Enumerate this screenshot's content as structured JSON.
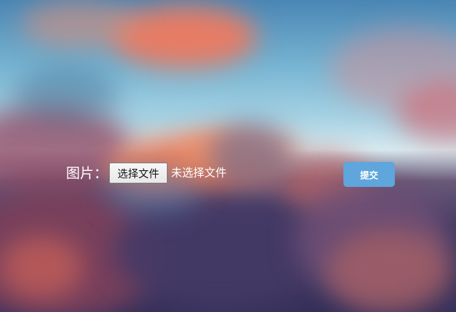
{
  "form": {
    "image_label": "图片：",
    "choose_file_label": "选择文件",
    "file_status": "未选择文件",
    "submit_label": "提交"
  },
  "colors": {
    "submit_button": "#5ea6db",
    "text": "#ffffff"
  }
}
